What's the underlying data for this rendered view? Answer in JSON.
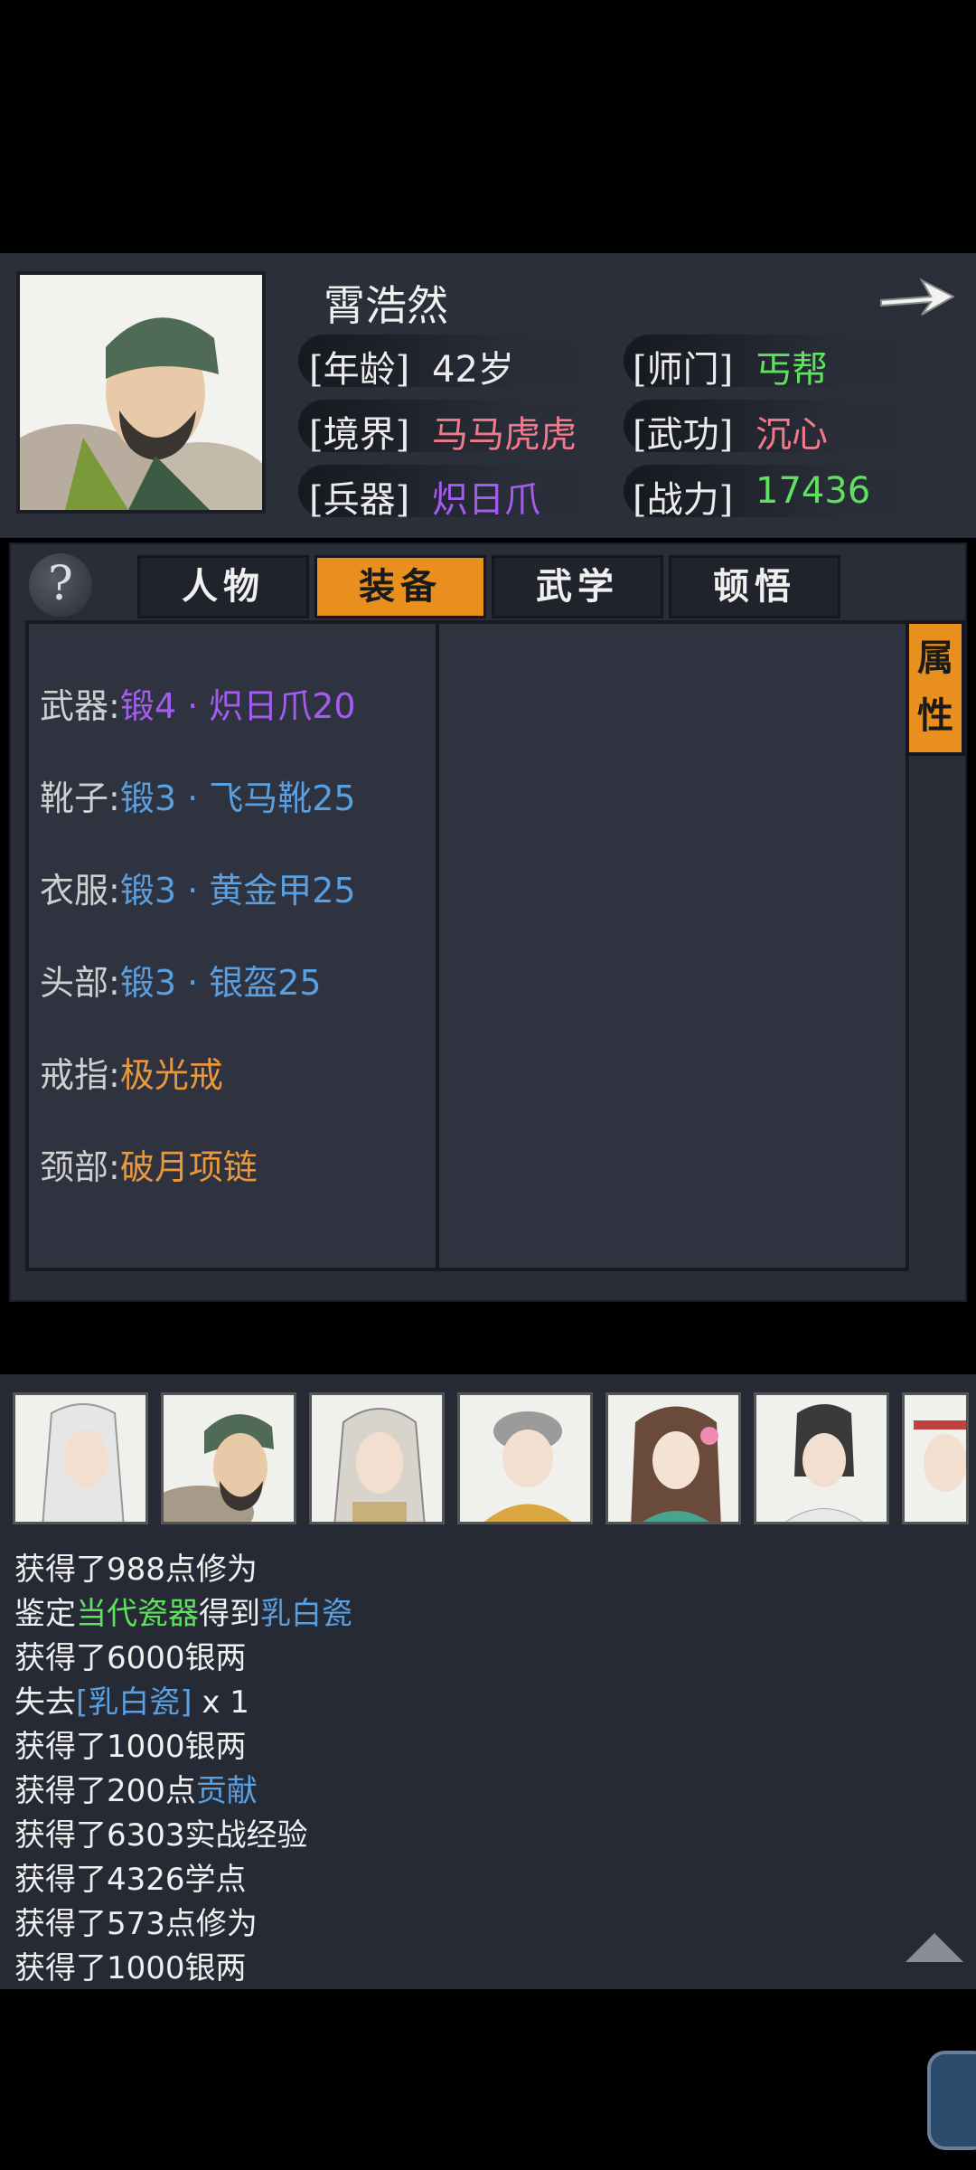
{
  "profile": {
    "name": "霄浩然",
    "age_label": "[年龄]",
    "age_value": "42岁",
    "sect_label": "[师门]",
    "sect_value": "丐帮",
    "realm_label": "[境界]",
    "realm_value": "马马虎虎",
    "martial_label": "[武功]",
    "martial_value": "沉心",
    "weapon_label": "[兵器]",
    "weapon_value": "炽日爪",
    "power_label": "[战力]",
    "power_value": "17436"
  },
  "tabs": [
    {
      "label": "人物",
      "active": false
    },
    {
      "label": "装备",
      "active": true
    },
    {
      "label": "武学",
      "active": false
    },
    {
      "label": "顿悟",
      "active": false
    }
  ],
  "help_label": "?",
  "side_tag": {
    "line1": "属",
    "line2": "性"
  },
  "equipment": [
    {
      "slot": "武器:",
      "item": "锻4 · 炽日爪20",
      "color": "#a45cf0"
    },
    {
      "slot": "靴子:",
      "item": "锻3 · 飞马靴25",
      "color": "#5a9fe0"
    },
    {
      "slot": "衣服:",
      "item": "锻3 · 黄金甲25",
      "color": "#5a9fe0"
    },
    {
      "slot": "头部:",
      "item": "锻3 · 银盔25",
      "color": "#5a9fe0"
    },
    {
      "slot": "戒指:",
      "item": "极光戒",
      "color": "#e8973a"
    },
    {
      "slot": "颈部:",
      "item": "破月项链",
      "color": "#e8973a"
    }
  ],
  "colors": {
    "green": "#5fe05f",
    "pink": "#f07a8a",
    "purple": "#a45cf0",
    "blue": "#5a9fe0",
    "orange": "#e88f1e"
  },
  "log": [
    {
      "parts": [
        {
          "t": "获得了988点修为",
          "c": ""
        }
      ]
    },
    {
      "parts": [
        {
          "t": "鉴定",
          "c": ""
        },
        {
          "t": "当代瓷器",
          "c": "#5fe05f"
        },
        {
          "t": "得到",
          "c": ""
        },
        {
          "t": "乳白瓷",
          "c": "#5a9fe0"
        }
      ]
    },
    {
      "parts": [
        {
          "t": "获得了6000银两",
          "c": ""
        }
      ]
    },
    {
      "parts": [
        {
          "t": "失去",
          "c": ""
        },
        {
          "t": "[乳白瓷]",
          "c": "#5a9fe0"
        },
        {
          "t": " x 1",
          "c": ""
        }
      ]
    },
    {
      "parts": [
        {
          "t": "获得了1000银两",
          "c": ""
        }
      ]
    },
    {
      "parts": [
        {
          "t": "获得了200点",
          "c": ""
        },
        {
          "t": "贡献",
          "c": "#5a9fe0"
        }
      ]
    },
    {
      "parts": [
        {
          "t": "获得了6303实战经验",
          "c": ""
        }
      ]
    },
    {
      "parts": [
        {
          "t": "获得了4326学点",
          "c": ""
        }
      ]
    },
    {
      "parts": [
        {
          "t": "获得了573点修为",
          "c": ""
        }
      ]
    },
    {
      "parts": [
        {
          "t": "获得了1000银两",
          "c": ""
        }
      ]
    }
  ]
}
